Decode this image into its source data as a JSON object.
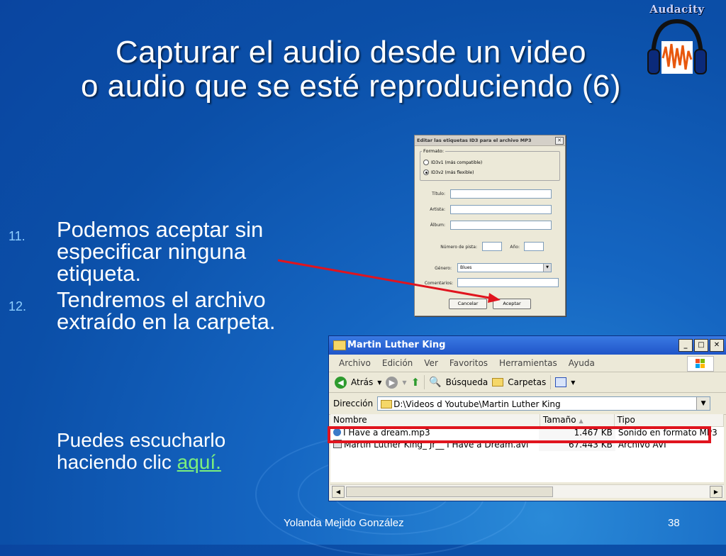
{
  "slide": {
    "title_line1": "Capturar el audio desde un video",
    "title_line2": "o audio que se esté reproduciendo (6)",
    "logo_text": "Audacity",
    "items": [
      {
        "num": "11.",
        "text": "Podemos aceptar sin especificar ninguna etiqueta."
      },
      {
        "num": "12.",
        "text": "Tendremos el archivo extraído en la carpeta."
      }
    ],
    "sub_text": "Puedes escucharlo haciendo clic",
    "sub_link": "aquí.",
    "footer_author": "Yolanda Mejido González",
    "footer_page": "38"
  },
  "colors": {
    "arrow": "#e0141e",
    "link": "#7cf07c",
    "highlight": "#e0141e"
  },
  "id3_dialog": {
    "title": "Editar las etiquetas ID3 para el archivo MP3",
    "format_legend": "Formato:",
    "opt1": "ID3v1 (más compatible)",
    "opt2": "ID3v2 (más flexible)",
    "selected_option": "ID3v2 (más flexible)",
    "title_label": "Título:",
    "artist_label": "Artista:",
    "album_label": "Álbum:",
    "track_label": "Número de pista:",
    "year_label": "Año:",
    "genre_label": "Género:",
    "genre_value": "Blues",
    "comments_label": "Comentarios:",
    "cancel_label": "Cancelar",
    "accept_label": "Aceptar"
  },
  "explorer": {
    "title": "Martin Luther King",
    "menu": [
      "Archivo",
      "Edición",
      "Ver",
      "Favoritos",
      "Herramientas",
      "Ayuda"
    ],
    "back_label": "Atrás",
    "search_label": "Búsqueda",
    "folders_label": "Carpetas",
    "address_label": "Dirección",
    "address_value": "D:\\Videos d Youtube\\Martin Luther King",
    "columns": [
      "Nombre",
      "Tamaño",
      "Tipo"
    ],
    "files": [
      {
        "name": "I Have a dream.mp3",
        "size": "1.467 KB",
        "type": "Sonido en formato MP3"
      },
      {
        "name": "Martin Luther King_ Jr__ I Have a Dream.avi",
        "size": "67.443 KB",
        "type": "Archivo AVI"
      }
    ]
  }
}
